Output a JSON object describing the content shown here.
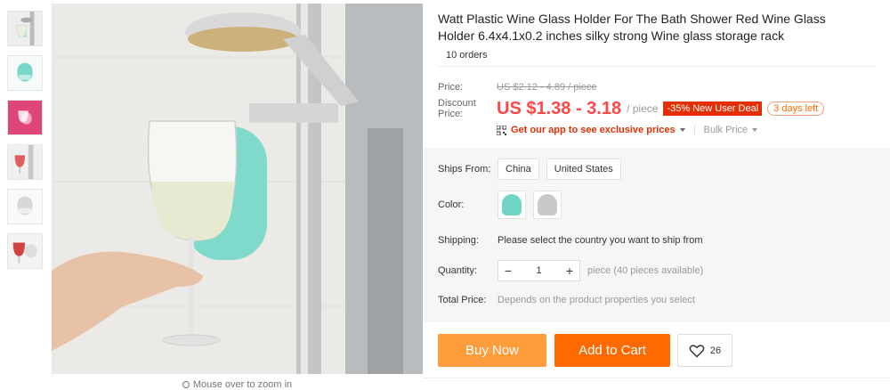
{
  "product": {
    "title": "Watt Plastic Wine Glass Holder For The Bath Shower Red Wine Glass Holder 6.4x4.1x0.2 inches silky strong Wine glass storage rack",
    "orders": "10 orders"
  },
  "gallery": {
    "zoom_hint": "Mouse over to zoom in",
    "thumbnail_count": 6
  },
  "price": {
    "price_label": "Price:",
    "original_price": "US $2.12 - 4.89 / piece",
    "discount_label": "Discount Price:",
    "discount_price": "US $1.38 - 3.18",
    "per_piece": "/ piece",
    "deal_badge": "-35% New User Deal",
    "days_left": "3 days left",
    "app_link": "Get our app to see exclusive prices",
    "bulk_price": "Bulk Price"
  },
  "properties": {
    "ships_from_label": "Ships From:",
    "ships_from_options": [
      "China",
      "United States"
    ],
    "color_label": "Color:",
    "color_options": [
      "teal",
      "gray"
    ],
    "shipping_label": "Shipping:",
    "shipping_text": "Please select the country you want to ship from",
    "quantity_label": "Quantity:",
    "quantity_value": "1",
    "quantity_available": "piece (40 pieces available)",
    "total_label": "Total Price:",
    "total_text": "Depends on the product properties you select"
  },
  "actions": {
    "buy_now": "Buy Now",
    "add_to_cart": "Add to Cart",
    "wishlist_count": "26"
  },
  "colors": {
    "accent_red": "#ff4747",
    "buy_now": "#ff9c3b",
    "add_to_cart": "#ff6a00",
    "deal_badge": "#e62e04",
    "teal_swatch": "#6fd6c5",
    "gray_swatch": "#c9c9c9"
  }
}
